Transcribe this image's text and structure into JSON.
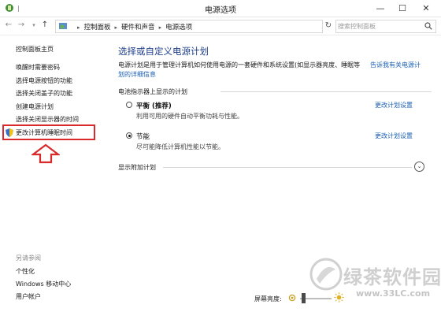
{
  "window": {
    "title": "电源选项",
    "minimize_label": "—",
    "maximize_label": "☐",
    "close_label": "✕"
  },
  "nav": {
    "breadcrumb": [
      "控制面板",
      "硬件和声音",
      "电源选项"
    ],
    "search_placeholder": "搜索控制面板"
  },
  "sidebar": {
    "home": "控制面板主页",
    "items": [
      "唤醒时需要密码",
      "选择电源按钮的功能",
      "选择关闭盖子的功能",
      "创建电源计划",
      "选择关闭显示器的时间",
      "更改计算机睡眠时间"
    ],
    "highlighted_item": "更改计算机睡眠时间",
    "see_also_label": "另请参阅",
    "see_also": [
      "个性化",
      "Windows 移动中心",
      "用户帐户"
    ]
  },
  "main": {
    "heading": "选择或自定义电源计划",
    "intro_text": "电源计划是用于管理计算机如何使用电源的一套硬件和系统设置(如显示器亮度、睡眠等",
    "intro_link_part1": "告诉我有关电源计",
    "intro_link_part2": "划的详细信息",
    "group_label": "电池指示器上显示的计划",
    "plans": [
      {
        "name": "平衡 (推荐)",
        "description": "利用可用的硬件自动平衡功耗与性能。",
        "change_link": "更改计划设置",
        "selected": false
      },
      {
        "name": "节能",
        "description": "尽可能降低计算机性能以节能。",
        "change_link": "更改计划设置",
        "selected": true
      }
    ],
    "more_plans_label": "显示附加计划",
    "brightness_label": "屏幕亮度:"
  },
  "watermark": {
    "text": "绿茶软件园",
    "url": "www.33LC.com"
  },
  "colors": {
    "heading": "#1e3e8a",
    "link": "#1a5fb4",
    "highlight_box": "#d9292a",
    "arrow": "#d9292a"
  },
  "icons": {
    "app": "power-options-icon",
    "shield": "uac-shield-icon",
    "arrow": "red-up-arrow"
  }
}
